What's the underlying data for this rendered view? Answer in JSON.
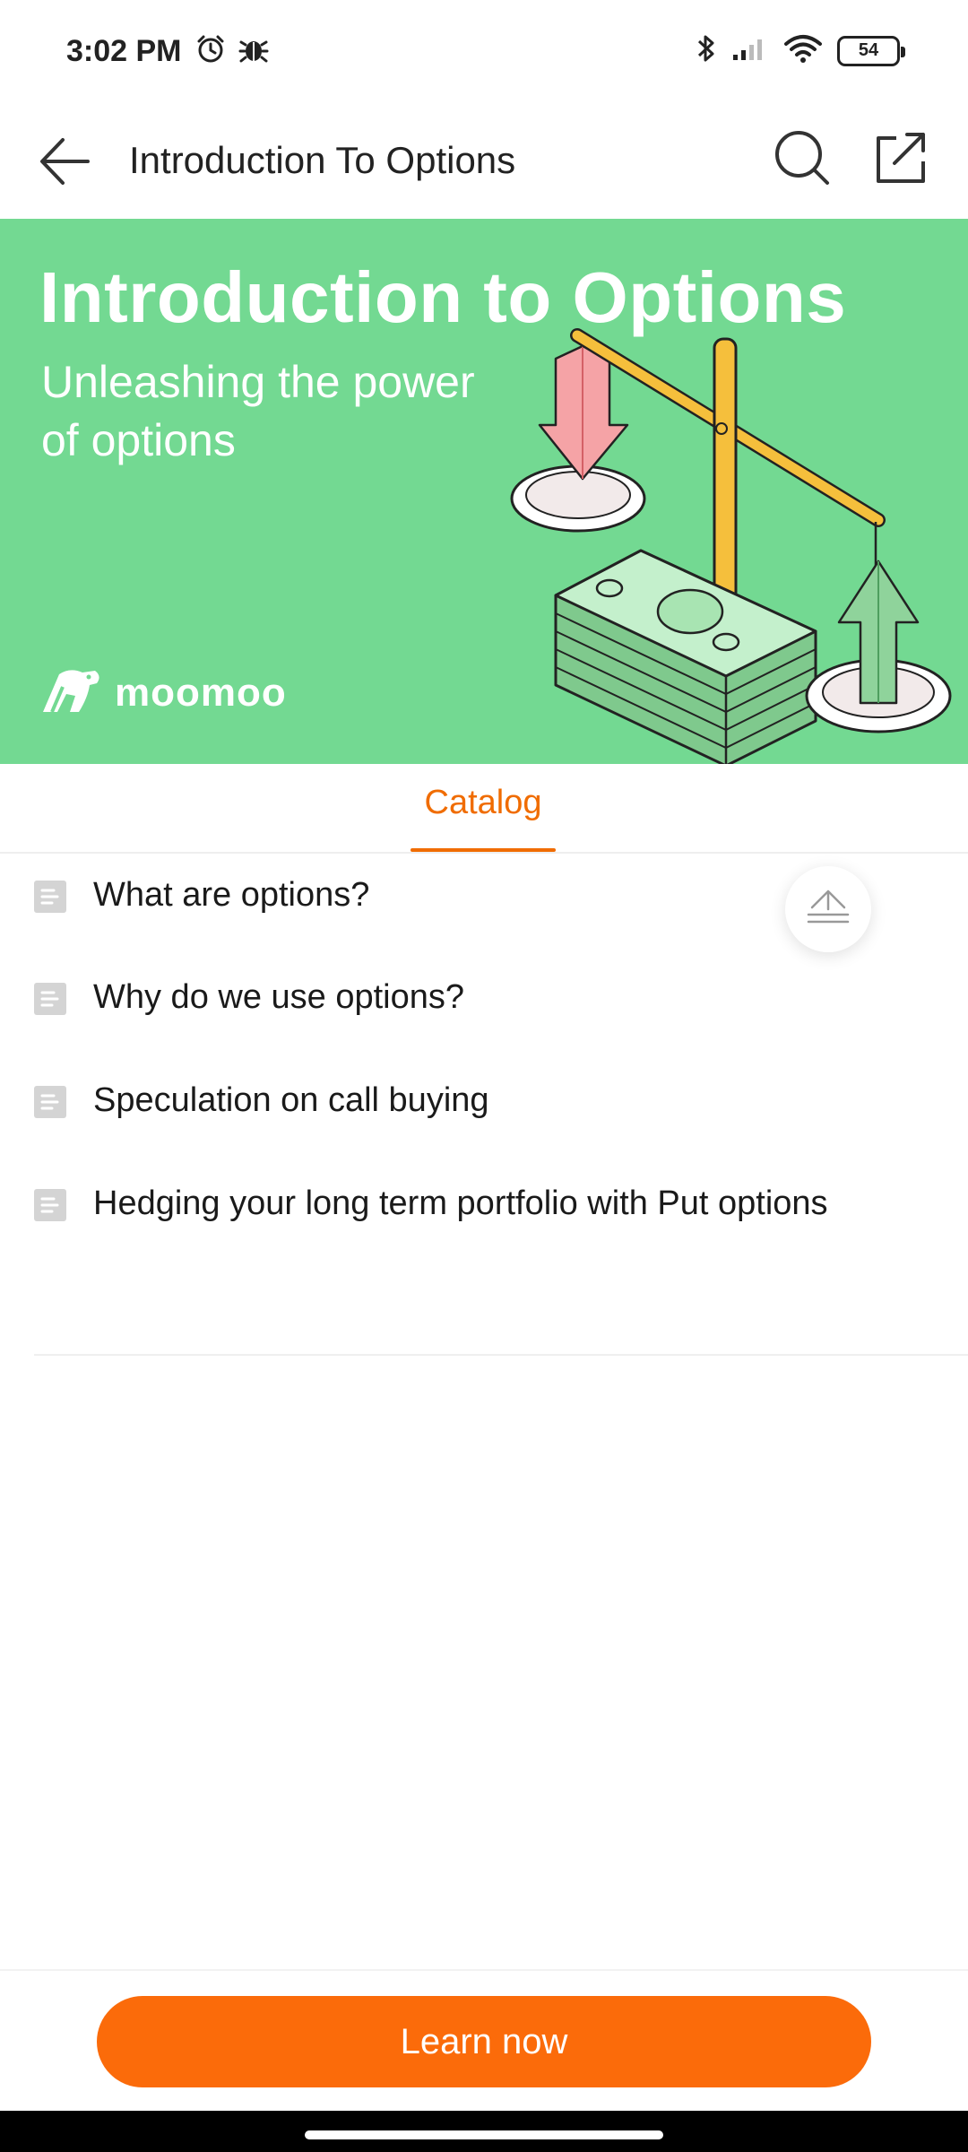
{
  "status_bar": {
    "time": "3:02 PM",
    "battery": "54",
    "icons": [
      "alarm-icon",
      "bug-icon",
      "bluetooth-icon",
      "signal-icon",
      "wifi-icon",
      "battery-icon"
    ]
  },
  "header": {
    "title": "Introduction To Options",
    "icons": [
      "back-arrow-icon",
      "search-icon",
      "share-icon"
    ]
  },
  "banner": {
    "title": "Introduction to Options",
    "subtitle_line1": "Unleashing the power",
    "subtitle_line2": "of options",
    "brand": "moomoo",
    "background_color": "#73d992"
  },
  "tabs": {
    "active": "Catalog"
  },
  "catalog": {
    "items": [
      {
        "label": "What are options?"
      },
      {
        "label": "Why do we use options?"
      },
      {
        "label": "Speculation on call buying"
      },
      {
        "label": "Hedging your long term portfolio with Put options"
      }
    ]
  },
  "bottom": {
    "cta_label": "Learn now",
    "cta_color": "#fb6b0a"
  },
  "colors": {
    "accent": "#f06c00"
  }
}
